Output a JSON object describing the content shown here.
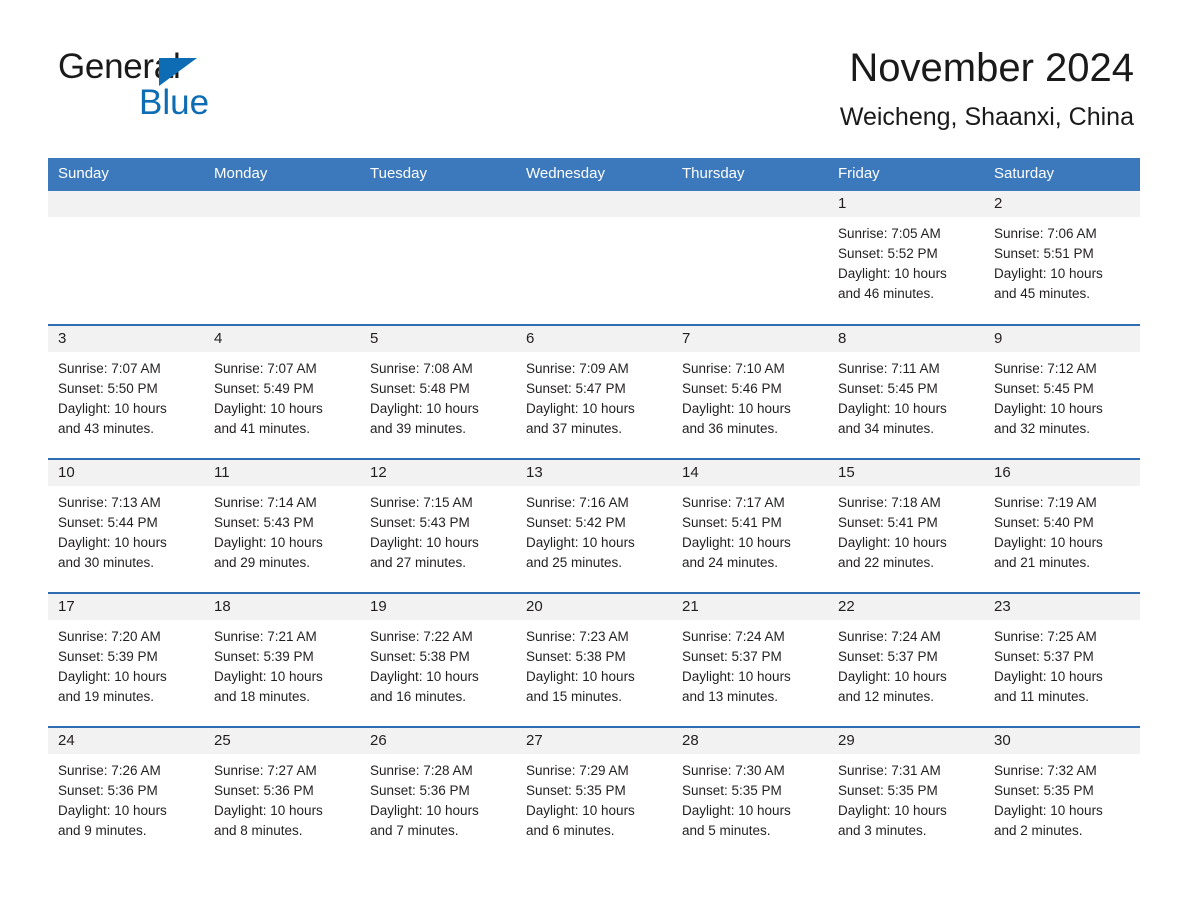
{
  "brand": {
    "line1": "General",
    "line2": "Blue",
    "triangle_color": "#0d6cb3"
  },
  "header": {
    "title": "November 2024",
    "subtitle": "Weicheng, Shaanxi, China",
    "header_bg": "#3b78bc",
    "row_border": "#2f6cb2",
    "daynum_band": "#f2f2f2"
  },
  "weekdays": [
    "Sunday",
    "Monday",
    "Tuesday",
    "Wednesday",
    "Thursday",
    "Friday",
    "Saturday"
  ],
  "labels": {
    "sunrise": "Sunrise:",
    "sunset": "Sunset:",
    "daylight": "Daylight:"
  },
  "weeks": [
    [
      {
        "day": "",
        "empty": true
      },
      {
        "day": "",
        "empty": true
      },
      {
        "day": "",
        "empty": true
      },
      {
        "day": "",
        "empty": true
      },
      {
        "day": "",
        "empty": true
      },
      {
        "day": "1",
        "sunrise": "Sunrise: 7:05 AM",
        "sunset": "Sunset: 5:52 PM",
        "daylight1": "Daylight: 10 hours",
        "daylight2": "and 46 minutes."
      },
      {
        "day": "2",
        "sunrise": "Sunrise: 7:06 AM",
        "sunset": "Sunset: 5:51 PM",
        "daylight1": "Daylight: 10 hours",
        "daylight2": "and 45 minutes."
      }
    ],
    [
      {
        "day": "3",
        "sunrise": "Sunrise: 7:07 AM",
        "sunset": "Sunset: 5:50 PM",
        "daylight1": "Daylight: 10 hours",
        "daylight2": "and 43 minutes."
      },
      {
        "day": "4",
        "sunrise": "Sunrise: 7:07 AM",
        "sunset": "Sunset: 5:49 PM",
        "daylight1": "Daylight: 10 hours",
        "daylight2": "and 41 minutes."
      },
      {
        "day": "5",
        "sunrise": "Sunrise: 7:08 AM",
        "sunset": "Sunset: 5:48 PM",
        "daylight1": "Daylight: 10 hours",
        "daylight2": "and 39 minutes."
      },
      {
        "day": "6",
        "sunrise": "Sunrise: 7:09 AM",
        "sunset": "Sunset: 5:47 PM",
        "daylight1": "Daylight: 10 hours",
        "daylight2": "and 37 minutes."
      },
      {
        "day": "7",
        "sunrise": "Sunrise: 7:10 AM",
        "sunset": "Sunset: 5:46 PM",
        "daylight1": "Daylight: 10 hours",
        "daylight2": "and 36 minutes."
      },
      {
        "day": "8",
        "sunrise": "Sunrise: 7:11 AM",
        "sunset": "Sunset: 5:45 PM",
        "daylight1": "Daylight: 10 hours",
        "daylight2": "and 34 minutes."
      },
      {
        "day": "9",
        "sunrise": "Sunrise: 7:12 AM",
        "sunset": "Sunset: 5:45 PM",
        "daylight1": "Daylight: 10 hours",
        "daylight2": "and 32 minutes."
      }
    ],
    [
      {
        "day": "10",
        "sunrise": "Sunrise: 7:13 AM",
        "sunset": "Sunset: 5:44 PM",
        "daylight1": "Daylight: 10 hours",
        "daylight2": "and 30 minutes."
      },
      {
        "day": "11",
        "sunrise": "Sunrise: 7:14 AM",
        "sunset": "Sunset: 5:43 PM",
        "daylight1": "Daylight: 10 hours",
        "daylight2": "and 29 minutes."
      },
      {
        "day": "12",
        "sunrise": "Sunrise: 7:15 AM",
        "sunset": "Sunset: 5:43 PM",
        "daylight1": "Daylight: 10 hours",
        "daylight2": "and 27 minutes."
      },
      {
        "day": "13",
        "sunrise": "Sunrise: 7:16 AM",
        "sunset": "Sunset: 5:42 PM",
        "daylight1": "Daylight: 10 hours",
        "daylight2": "and 25 minutes."
      },
      {
        "day": "14",
        "sunrise": "Sunrise: 7:17 AM",
        "sunset": "Sunset: 5:41 PM",
        "daylight1": "Daylight: 10 hours",
        "daylight2": "and 24 minutes."
      },
      {
        "day": "15",
        "sunrise": "Sunrise: 7:18 AM",
        "sunset": "Sunset: 5:41 PM",
        "daylight1": "Daylight: 10 hours",
        "daylight2": "and 22 minutes."
      },
      {
        "day": "16",
        "sunrise": "Sunrise: 7:19 AM",
        "sunset": "Sunset: 5:40 PM",
        "daylight1": "Daylight: 10 hours",
        "daylight2": "and 21 minutes."
      }
    ],
    [
      {
        "day": "17",
        "sunrise": "Sunrise: 7:20 AM",
        "sunset": "Sunset: 5:39 PM",
        "daylight1": "Daylight: 10 hours",
        "daylight2": "and 19 minutes."
      },
      {
        "day": "18",
        "sunrise": "Sunrise: 7:21 AM",
        "sunset": "Sunset: 5:39 PM",
        "daylight1": "Daylight: 10 hours",
        "daylight2": "and 18 minutes."
      },
      {
        "day": "19",
        "sunrise": "Sunrise: 7:22 AM",
        "sunset": "Sunset: 5:38 PM",
        "daylight1": "Daylight: 10 hours",
        "daylight2": "and 16 minutes."
      },
      {
        "day": "20",
        "sunrise": "Sunrise: 7:23 AM",
        "sunset": "Sunset: 5:38 PM",
        "daylight1": "Daylight: 10 hours",
        "daylight2": "and 15 minutes."
      },
      {
        "day": "21",
        "sunrise": "Sunrise: 7:24 AM",
        "sunset": "Sunset: 5:37 PM",
        "daylight1": "Daylight: 10 hours",
        "daylight2": "and 13 minutes."
      },
      {
        "day": "22",
        "sunrise": "Sunrise: 7:24 AM",
        "sunset": "Sunset: 5:37 PM",
        "daylight1": "Daylight: 10 hours",
        "daylight2": "and 12 minutes."
      },
      {
        "day": "23",
        "sunrise": "Sunrise: 7:25 AM",
        "sunset": "Sunset: 5:37 PM",
        "daylight1": "Daylight: 10 hours",
        "daylight2": "and 11 minutes."
      }
    ],
    [
      {
        "day": "24",
        "sunrise": "Sunrise: 7:26 AM",
        "sunset": "Sunset: 5:36 PM",
        "daylight1": "Daylight: 10 hours",
        "daylight2": "and 9 minutes."
      },
      {
        "day": "25",
        "sunrise": "Sunrise: 7:27 AM",
        "sunset": "Sunset: 5:36 PM",
        "daylight1": "Daylight: 10 hours",
        "daylight2": "and 8 minutes."
      },
      {
        "day": "26",
        "sunrise": "Sunrise: 7:28 AM",
        "sunset": "Sunset: 5:36 PM",
        "daylight1": "Daylight: 10 hours",
        "daylight2": "and 7 minutes."
      },
      {
        "day": "27",
        "sunrise": "Sunrise: 7:29 AM",
        "sunset": "Sunset: 5:35 PM",
        "daylight1": "Daylight: 10 hours",
        "daylight2": "and 6 minutes."
      },
      {
        "day": "28",
        "sunrise": "Sunrise: 7:30 AM",
        "sunset": "Sunset: 5:35 PM",
        "daylight1": "Daylight: 10 hours",
        "daylight2": "and 5 minutes."
      },
      {
        "day": "29",
        "sunrise": "Sunrise: 7:31 AM",
        "sunset": "Sunset: 5:35 PM",
        "daylight1": "Daylight: 10 hours",
        "daylight2": "and 3 minutes."
      },
      {
        "day": "30",
        "sunrise": "Sunrise: 7:32 AM",
        "sunset": "Sunset: 5:35 PM",
        "daylight1": "Daylight: 10 hours",
        "daylight2": "and 2 minutes."
      }
    ]
  ]
}
